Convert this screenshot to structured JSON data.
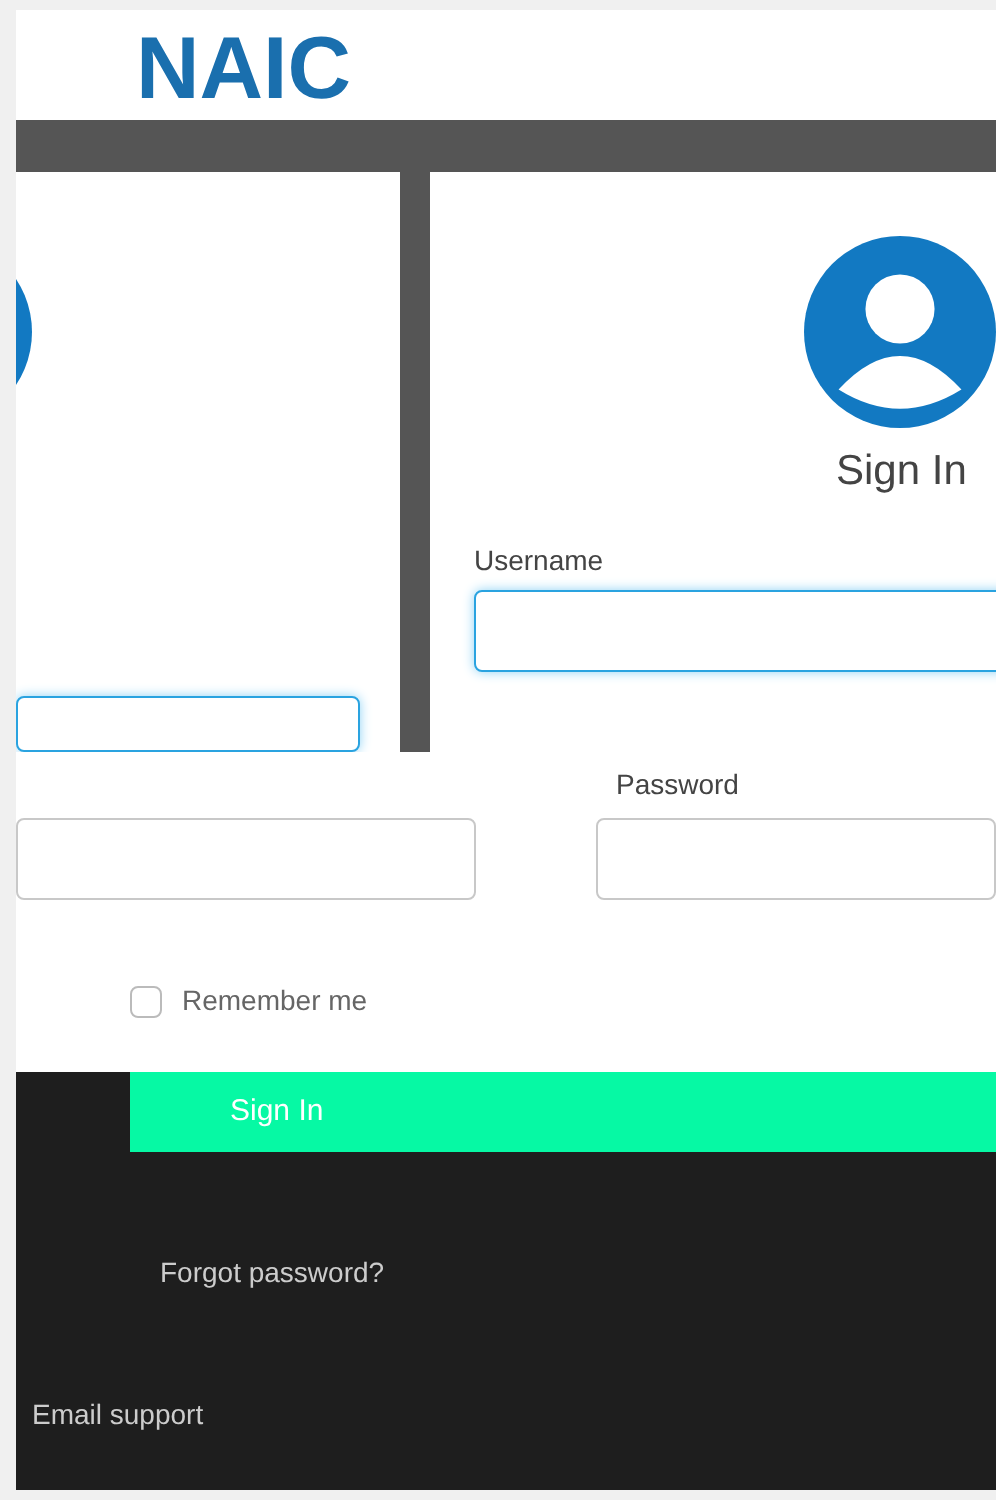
{
  "header": {
    "logo": "NAIC"
  },
  "panels": [
    {
      "username_focused": true
    },
    {
      "title": "Sign In",
      "username_label": "Username",
      "username_focused": true
    }
  ],
  "password": {
    "label": "Password"
  },
  "remember": {
    "label": "Remember me",
    "checked": false
  },
  "sign_in_button": "Sign In",
  "footer": {
    "links": [
      "Forgot password?",
      "Email support"
    ]
  }
}
